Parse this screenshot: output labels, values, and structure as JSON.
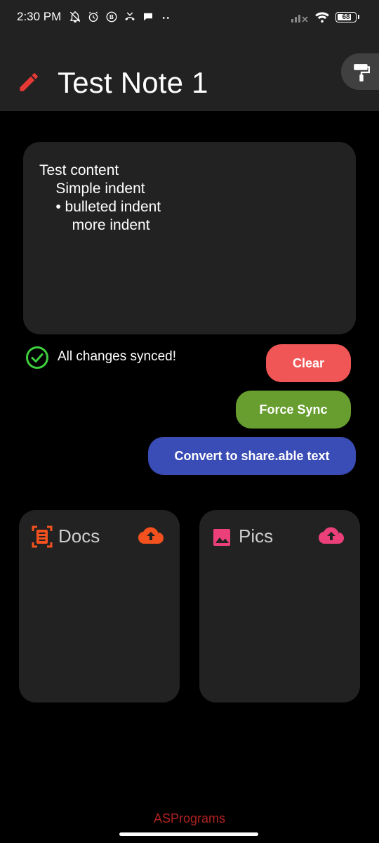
{
  "status_bar": {
    "time": "2:30 PM",
    "icons_left": [
      "bell-off-icon",
      "alarm-icon",
      "b-badge-icon",
      "missed-call-icon",
      "chat-bubble-icon",
      "more-dots-icon"
    ],
    "icons_right": [
      "signal-off-icon",
      "wifi-icon",
      "battery-icon"
    ],
    "battery_level": "68"
  },
  "app_bar": {
    "title": "Test Note 1",
    "icon": "pencil-icon",
    "theme_button_icon": "paint-roller-icon"
  },
  "note": {
    "content": "Test content\n    Simple indent\n    • bulleted indent\n        more indent"
  },
  "sync": {
    "status_text": "All changes synced!",
    "icon": "check-circle-icon"
  },
  "buttons": {
    "clear_label": "Clear",
    "force_sync_label": "Force Sync",
    "convert_label": "Convert to share.able text"
  },
  "cards": {
    "docs": {
      "title": "Docs",
      "icon": "document-scan-icon",
      "action_icon": "cloud-upload-icon"
    },
    "pics": {
      "title": "Pics",
      "icon": "image-icon",
      "action_icon": "cloud-upload-icon"
    }
  },
  "footer": {
    "brand": "ASPrograms"
  },
  "colors": {
    "background": "#000000",
    "surface": "#222222",
    "accent_red": "#e53935",
    "clear_button": "#f15656",
    "force_sync_button": "#679e2f",
    "convert_button": "#3a4cb5",
    "docs_accent": "#f4511e",
    "pics_accent": "#ec407a",
    "sync_green": "#4caf50"
  }
}
